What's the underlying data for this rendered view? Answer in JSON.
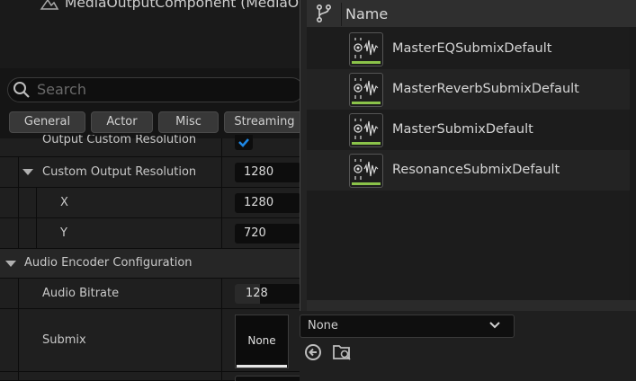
{
  "component": {
    "label": "MediaOutputComponent (MediaO"
  },
  "search": {
    "placeholder": "Search"
  },
  "filters": [
    "General",
    "Actor",
    "Misc",
    "Streaming"
  ],
  "properties": {
    "output_custom_resolution": {
      "label": "Output Custom Resolution",
      "checked": true
    },
    "custom_output_resolution": {
      "label": "Custom Output Resolution",
      "value": "1280"
    },
    "x": {
      "label": "X",
      "value": "1280"
    },
    "y": {
      "label": "Y",
      "value": "720"
    },
    "audio_encoder_configuration": {
      "label": "Audio Encoder Configuration"
    },
    "audio_bitrate": {
      "label": "Audio Bitrate",
      "value": "128"
    },
    "submix": {
      "label": "Submix",
      "thumbnail_text": "None",
      "combo_value": "None"
    }
  },
  "asset_picker": {
    "column_header": "Name",
    "assets": [
      {
        "name": "MasterEQSubmixDefault"
      },
      {
        "name": "MasterReverbSubmixDefault"
      },
      {
        "name": "MasterSubmixDefault"
      },
      {
        "name": "ResonanceSubmixDefault"
      }
    ]
  },
  "colors": {
    "asset_type_bar": "#8bc34a",
    "checkbox_accent": "#1e88e5"
  }
}
